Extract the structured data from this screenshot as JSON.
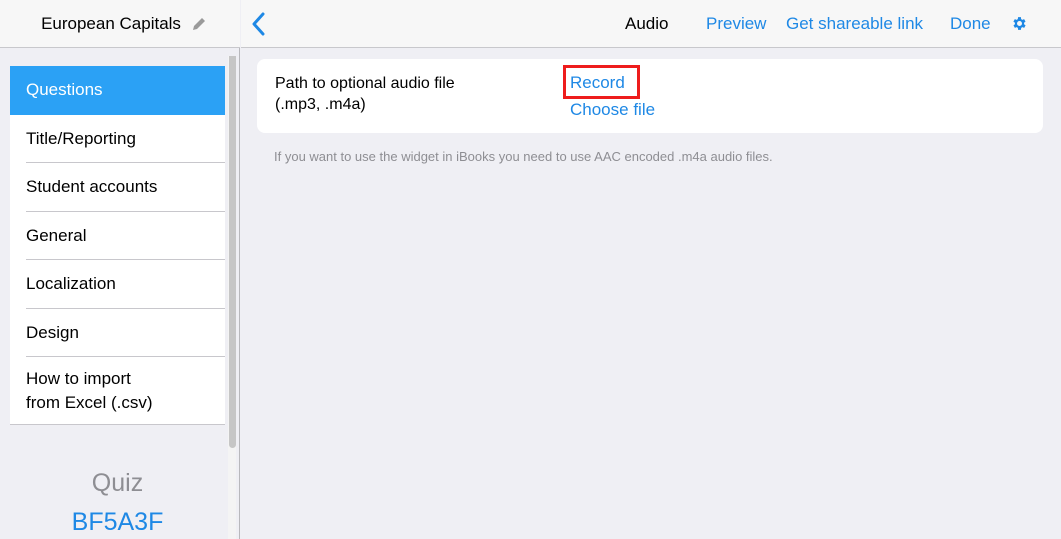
{
  "sidebar": {
    "title": "European Capitals",
    "edit_icon": "pencil-icon",
    "items": [
      {
        "label": "Questions",
        "active": true
      },
      {
        "label": "Title/Reporting"
      },
      {
        "label": "Student accounts"
      },
      {
        "label": "General"
      },
      {
        "label": "Localization"
      },
      {
        "label": "Design"
      },
      {
        "label": "How to import\nfrom Excel (.csv)"
      }
    ],
    "quiz_label": "Quiz",
    "quiz_code": "BF5A3F"
  },
  "topbar": {
    "back_icon": "chevron-left-icon",
    "title": "Audio",
    "preview": "Preview",
    "share": "Get shareable link",
    "done": "Done",
    "settings_icon": "gear-icon"
  },
  "audio": {
    "field_label": "Path to optional audio file\n(.mp3, .m4a)",
    "record": "Record",
    "choose_file": "Choose file",
    "hint": "If you want to use the widget in iBooks you need to use AAC encoded .m4a audio files."
  },
  "colors": {
    "accent": "#1e88e5",
    "active_item": "#2ba1f5",
    "highlight_box": "#ee1c1c"
  }
}
